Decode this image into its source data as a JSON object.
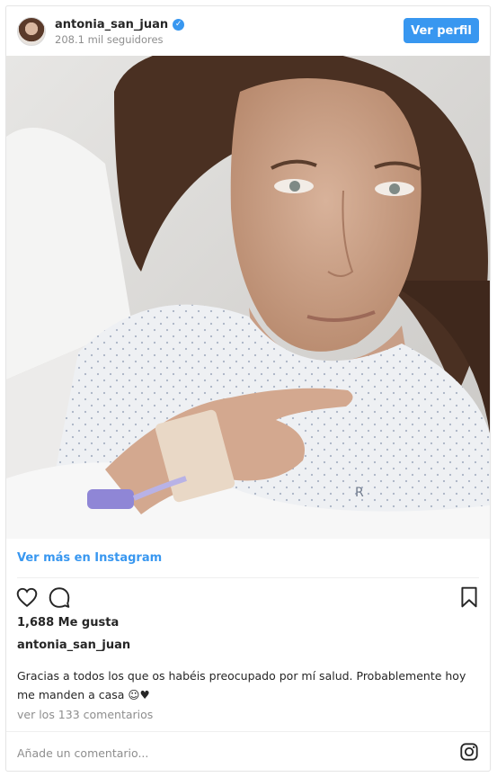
{
  "header": {
    "username": "antonia_san_juan",
    "verified_glyph": "✓",
    "followers": "208.1 mil seguidores",
    "follow_label": "Ver perfil"
  },
  "photo": {
    "stamp": "R"
  },
  "post": {
    "view_more": "Ver más en Instagram",
    "likes": "1,688 Me gusta",
    "caption_user": "antonia_san_juan",
    "caption": "Gracias a todos los que os habéis preocupado por mí salud. Probablemente hoy me manden a casa ☺♥",
    "comments_link": "ver los 133 comentarios",
    "comment_placeholder": "Añade un comentario..."
  },
  "icons": {
    "like": "heart-outline-icon",
    "comment": "speech-bubble-icon",
    "save": "bookmark-icon",
    "brand": "instagram-icon"
  },
  "colors": {
    "accent": "#3897f0",
    "text": "#262626",
    "muted": "#8e8e8e",
    "border": "#e6e6e6"
  }
}
